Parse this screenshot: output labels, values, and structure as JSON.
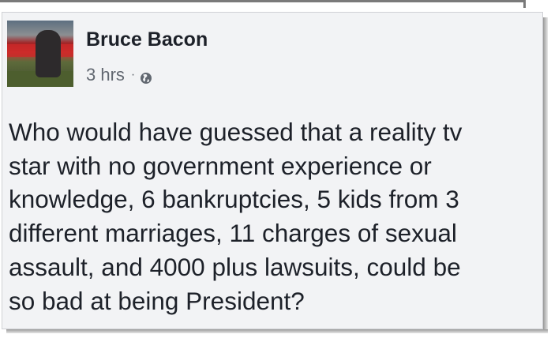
{
  "post": {
    "author": "Bruce Bacon",
    "timestamp": "3 hrs",
    "separator": "·",
    "privacy_icon": "globe-icon",
    "text": "Who would have guessed that a reality tv\nstar with no government experience or\nknowledge, 6 bankruptcies, 5 kids from 3\ndifferent marriages, 11 charges of sexual\nassault, and 4000 plus lawsuits, could be\nso bad at being President?"
  },
  "colors": {
    "card_background": "#f2f3f5",
    "author_name": "#1d2129",
    "meta_text": "#616770",
    "body_text": "#1d2129"
  }
}
